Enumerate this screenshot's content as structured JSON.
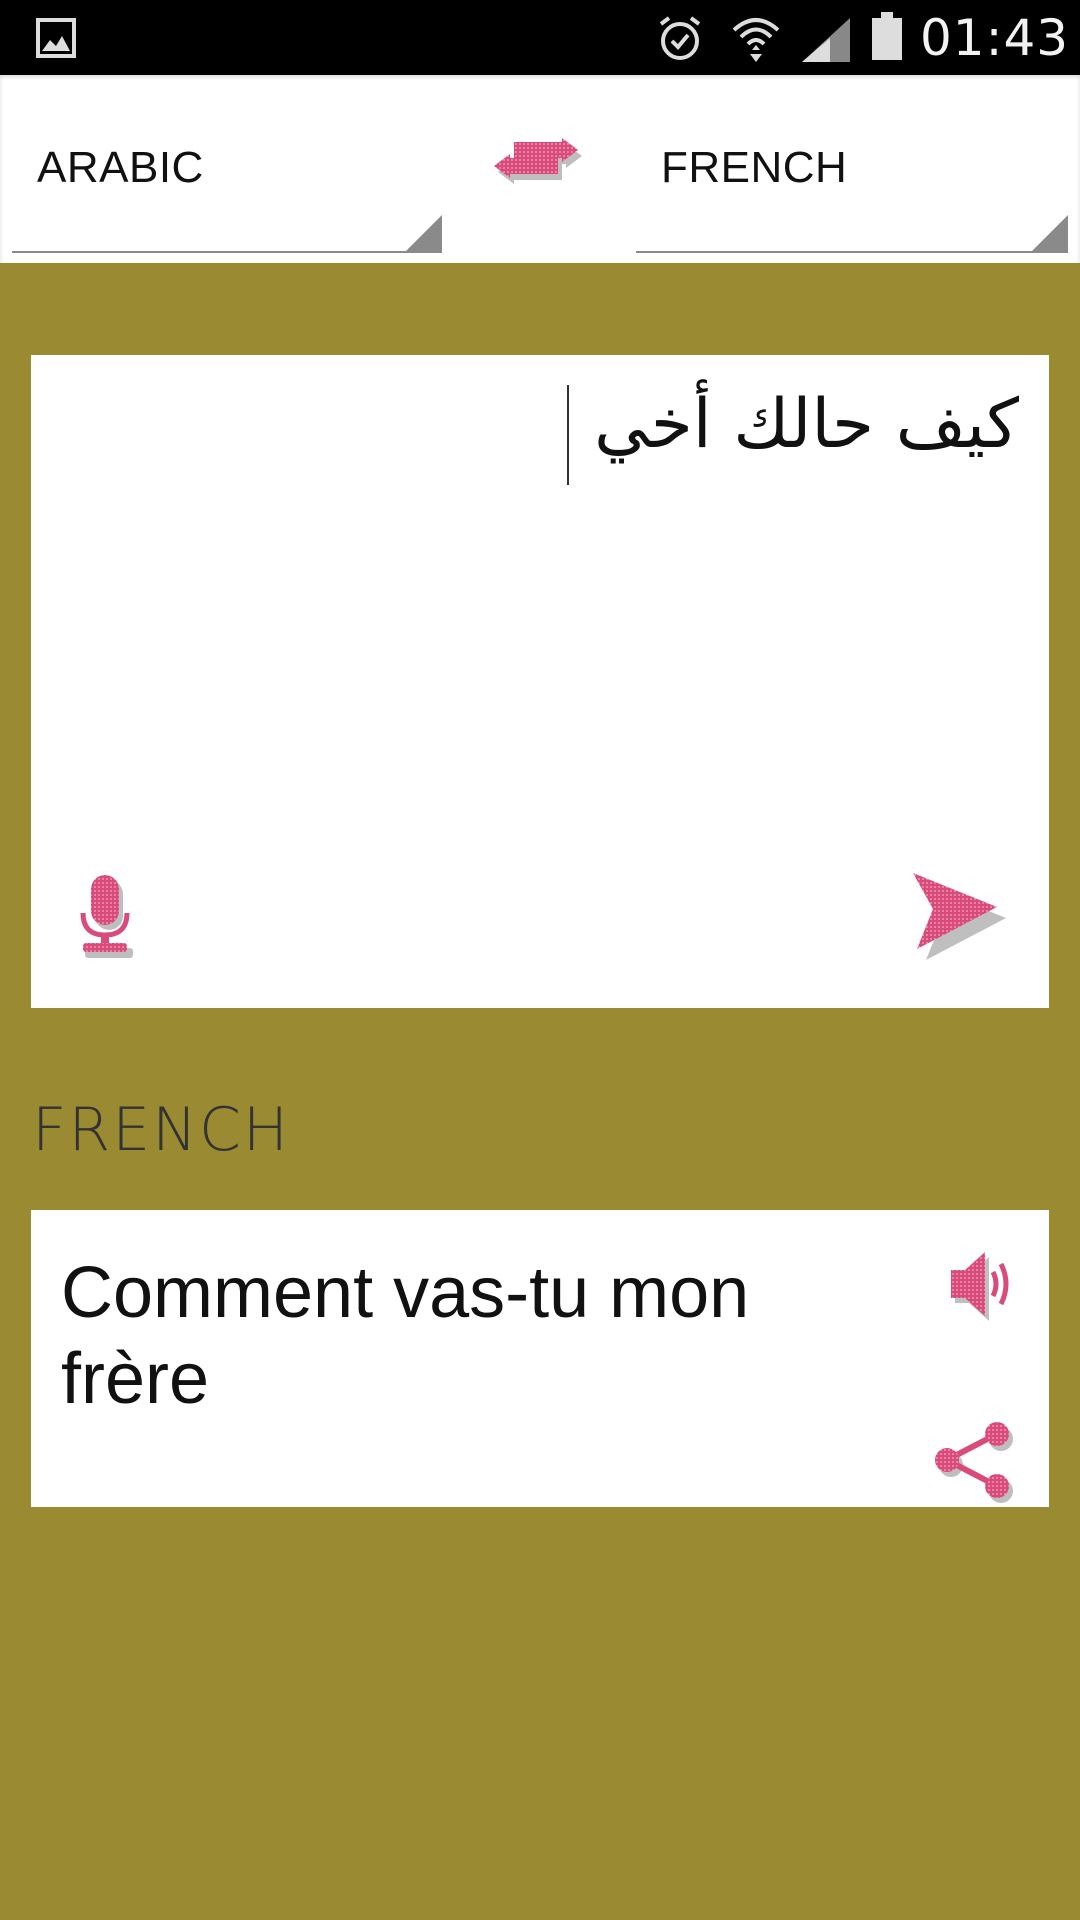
{
  "status_bar": {
    "time": "01:43",
    "icons": [
      "gallery-icon",
      "alarm-icon",
      "wifi-icon",
      "signal-icon",
      "battery-icon"
    ]
  },
  "languages": {
    "source": "ARABIC",
    "target": "FRENCH"
  },
  "input": {
    "text": "كيف حالك  أخي"
  },
  "output": {
    "language_label": "FRENCH",
    "text": "Comment vas-tu mon frère"
  },
  "colors": {
    "background": "#9a8b32",
    "accent": "#d84b7a",
    "card": "#ffffff"
  }
}
